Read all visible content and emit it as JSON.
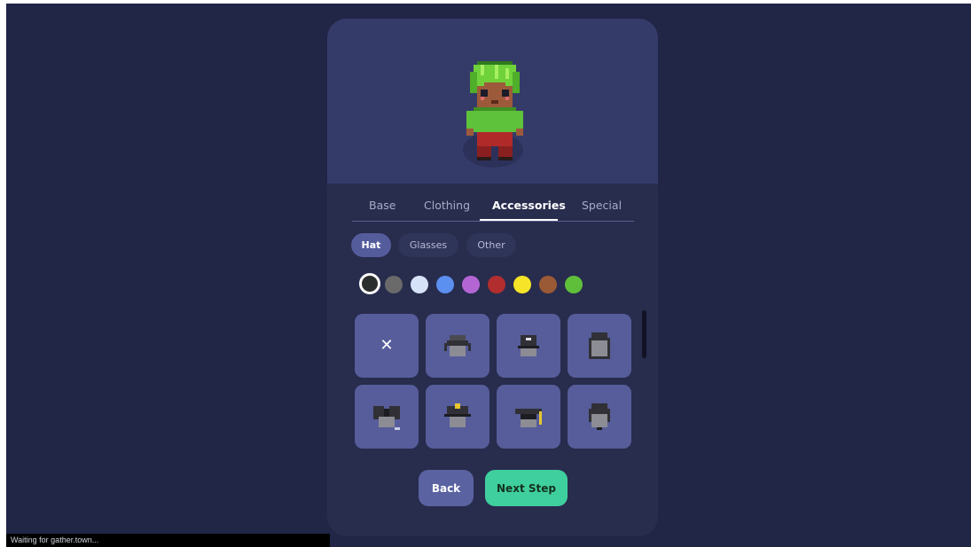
{
  "tabs": [
    {
      "label": "Base",
      "active": false
    },
    {
      "label": "Clothing",
      "active": false
    },
    {
      "label": "Accessories",
      "active": true
    },
    {
      "label": "Special",
      "active": false
    }
  ],
  "subtabs": [
    {
      "label": "Hat",
      "active": true
    },
    {
      "label": "Glasses",
      "active": false
    },
    {
      "label": "Other",
      "active": false
    }
  ],
  "colors": [
    "#2a2e2c",
    "#6a6a6a",
    "#d6e2f8",
    "#5b8ff0",
    "#b465d4",
    "#b22e2e",
    "#f5e427",
    "#9a5a36",
    "#5fbf3a"
  ],
  "selected_color_index": 0,
  "items": [
    {
      "icon": "none-x-icon",
      "glyph": "✕"
    },
    {
      "icon": "beanie-hat-icon"
    },
    {
      "icon": "cap-hat-icon"
    },
    {
      "icon": "hood-hat-icon"
    },
    {
      "icon": "bow-hat-icon"
    },
    {
      "icon": "police-hat-icon"
    },
    {
      "icon": "graduation-cap-icon"
    },
    {
      "icon": "helmet-hat-icon"
    }
  ],
  "buttons": {
    "back": "Back",
    "next": "Next Step"
  },
  "status_text": "Waiting for gather.town..."
}
